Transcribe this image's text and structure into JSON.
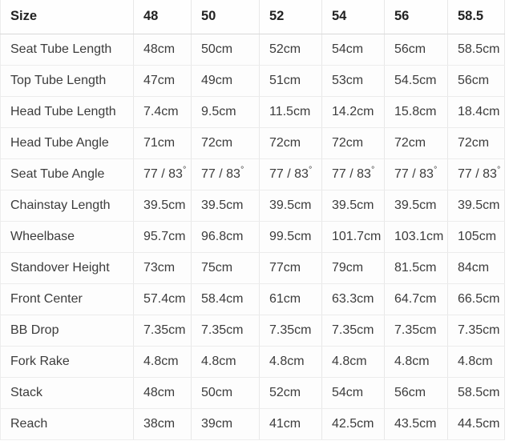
{
  "table": {
    "corner_label": "Size",
    "size_columns": [
      "48",
      "50",
      "52",
      "54",
      "56",
      "58.5"
    ],
    "rows": [
      {
        "label": "Seat Tube Length",
        "values": [
          "48cm",
          "50cm",
          "52cm",
          "54cm",
          "56cm",
          "58.5cm"
        ]
      },
      {
        "label": "Top Tube Length",
        "values": [
          "47cm",
          "49cm",
          "51cm",
          "53cm",
          "54.5cm",
          "56cm"
        ]
      },
      {
        "label": "Head Tube Length",
        "values": [
          "7.4cm",
          "9.5cm",
          "11.5cm",
          "14.2cm",
          "15.8cm",
          "18.4cm"
        ]
      },
      {
        "label": "Head Tube Angle",
        "values": [
          "71cm",
          "72cm",
          "72cm",
          "72cm",
          "72cm",
          "72cm"
        ]
      },
      {
        "label": "Seat Tube Angle",
        "values": [
          "77 / 83°",
          "77 / 83°",
          "77 / 83°",
          "77 / 83°",
          "77 / 83°",
          "77 / 83°"
        ]
      },
      {
        "label": "Chainstay Length",
        "values": [
          "39.5cm",
          "39.5cm",
          "39.5cm",
          "39.5cm",
          "39.5cm",
          "39.5cm"
        ]
      },
      {
        "label": "Wheelbase",
        "values": [
          "95.7cm",
          "96.8cm",
          "99.5cm",
          "101.7cm",
          "103.1cm",
          "105cm"
        ]
      },
      {
        "label": "Standover Height",
        "values": [
          "73cm",
          "75cm",
          "77cm",
          "79cm",
          "81.5cm",
          "84cm"
        ]
      },
      {
        "label": "Front Center",
        "values": [
          "57.4cm",
          "58.4cm",
          "61cm",
          "63.3cm",
          "64.7cm",
          "66.5cm"
        ]
      },
      {
        "label": "BB Drop",
        "values": [
          "7.35cm",
          "7.35cm",
          "7.35cm",
          "7.35cm",
          "7.35cm",
          "7.35cm"
        ]
      },
      {
        "label": "Fork Rake",
        "values": [
          "4.8cm",
          "4.8cm",
          "4.8cm",
          "4.8cm",
          "4.8cm",
          "4.8cm"
        ]
      },
      {
        "label": "Stack",
        "values": [
          "48cm",
          "50cm",
          "52cm",
          "54cm",
          "56cm",
          "58.5cm"
        ]
      },
      {
        "label": "Reach",
        "values": [
          "38cm",
          "39cm",
          "41cm",
          "42.5cm",
          "43.5cm",
          "44.5cm"
        ]
      }
    ]
  },
  "colors": {
    "text": "#3c3c3c",
    "header_text": "#222222",
    "border": "#ececec",
    "background": "#fdfdfd"
  }
}
